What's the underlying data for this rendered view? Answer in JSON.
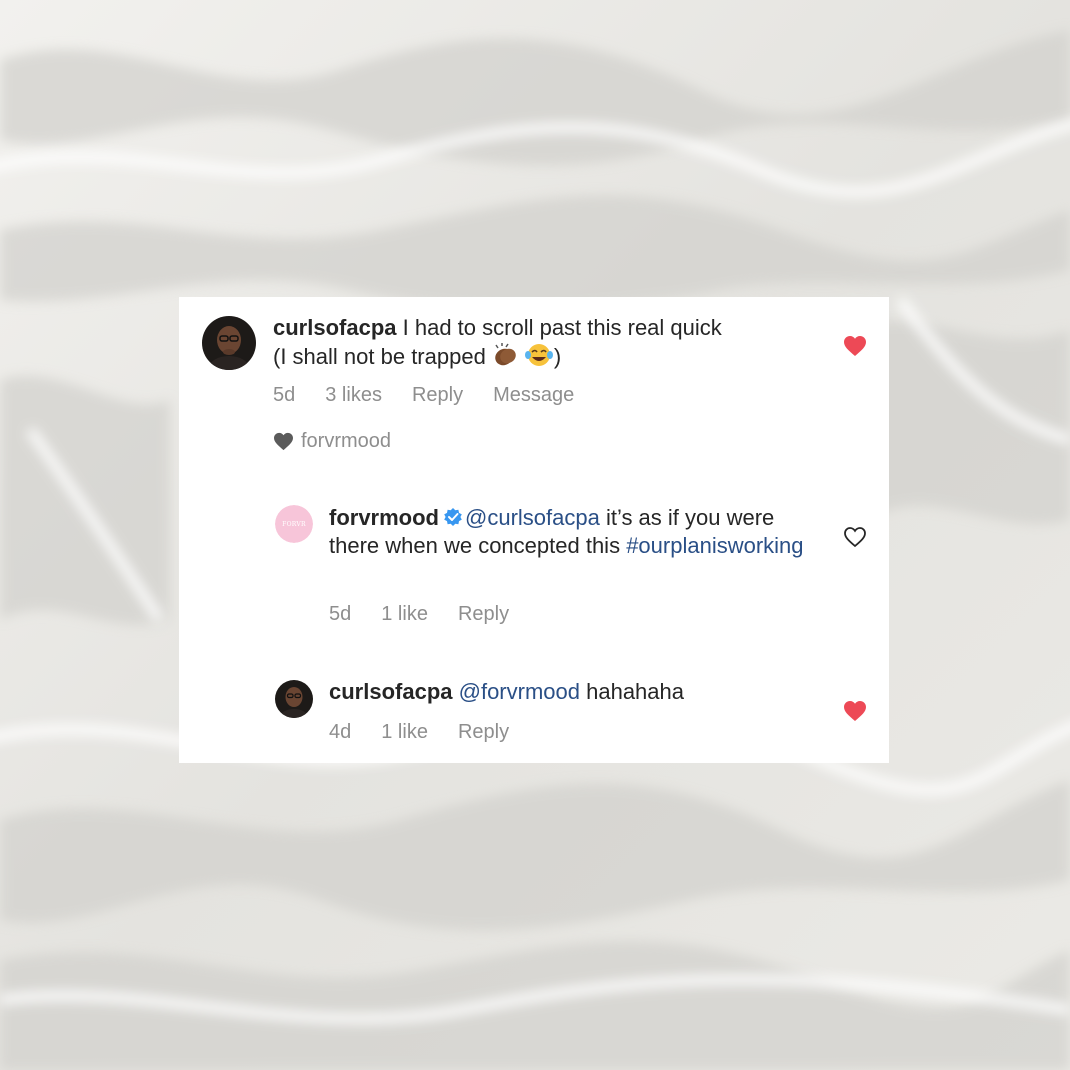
{
  "comments": [
    {
      "username": "curlsofacpa",
      "text_line1": "I had to scroll past this real quick",
      "text_line2_pre": "(I shall not be trapped",
      "text_line2_post": ")",
      "emoji_icons": [
        "clapping-hands-icon",
        "laughing-tears-icon"
      ],
      "time": "5d",
      "likes": "3 likes",
      "reply_label": "Reply",
      "message_label": "Message",
      "liked_by": "forvrmood",
      "liked": true
    },
    {
      "username": "forvrmood",
      "verified": true,
      "mention": "@curlsofacpa",
      "text": " it’s as if you were there when we concepted this ",
      "hashtag": "#ourplanisworking",
      "avatar_text": "FORVR",
      "time": "5d",
      "likes": "1 like",
      "reply_label": "Reply",
      "liked": false
    },
    {
      "username": "curlsofacpa",
      "mention": "@forvrmood",
      "text": " hahahaha",
      "time": "4d",
      "likes": "1 like",
      "reply_label": "Reply",
      "liked": true
    }
  ],
  "colors": {
    "heart_liked": "#ed4956",
    "verified_badge": "#3897f0",
    "link": "#2a4f86",
    "meta_text": "#8e8e8e",
    "text": "#262626",
    "brand_avatar": "#f7c5d9"
  }
}
